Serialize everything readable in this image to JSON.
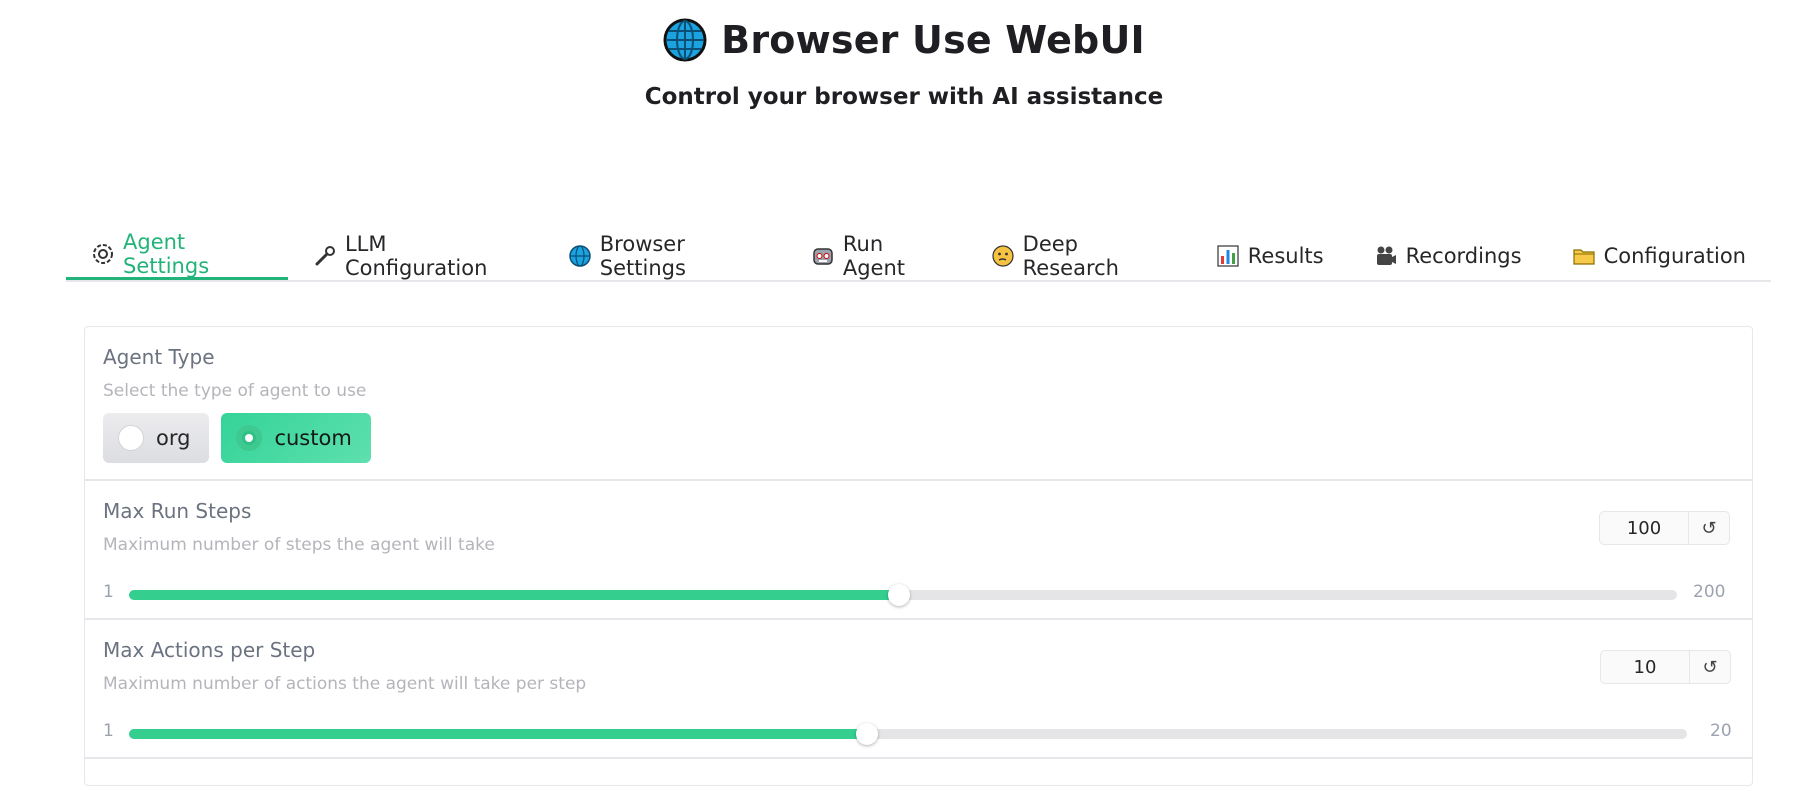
{
  "header": {
    "title": "Browser Use WebUI",
    "subtitle": "Control your browser with AI assistance",
    "icon": "globe-icon"
  },
  "tabs": [
    {
      "label": "Agent Settings",
      "icon": "gear-icon",
      "active": true
    },
    {
      "label": "LLM Configuration",
      "icon": "wrench-icon",
      "active": false
    },
    {
      "label": "Browser Settings",
      "icon": "globe-icon",
      "active": false
    },
    {
      "label": "Run Agent",
      "icon": "robot-icon",
      "active": false
    },
    {
      "label": "Deep Research",
      "icon": "thinking-face-icon",
      "active": false
    },
    {
      "label": "Results",
      "icon": "bar-chart-icon",
      "active": false
    },
    {
      "label": "Recordings",
      "icon": "movie-camera-icon",
      "active": false
    },
    {
      "label": "Configuration",
      "icon": "folder-icon",
      "active": false
    }
  ],
  "agent_type": {
    "label": "Agent Type",
    "info": "Select the type of agent to use",
    "options": [
      "org",
      "custom"
    ],
    "selected": "custom"
  },
  "max_run_steps": {
    "label": "Max Run Steps",
    "info": "Maximum number of steps the agent will take",
    "value": "100",
    "min": "1",
    "max": "200",
    "reset_icon": "reset-icon"
  },
  "max_actions": {
    "label": "Max Actions per Step",
    "info": "Maximum number of actions the agent will take per step",
    "value": "10",
    "min": "1",
    "max": "20",
    "reset_icon": "reset-icon"
  },
  "colors": {
    "accent": "#22b37a",
    "slider_fill": "#34cf8f",
    "radio_selected": "#34d399"
  }
}
